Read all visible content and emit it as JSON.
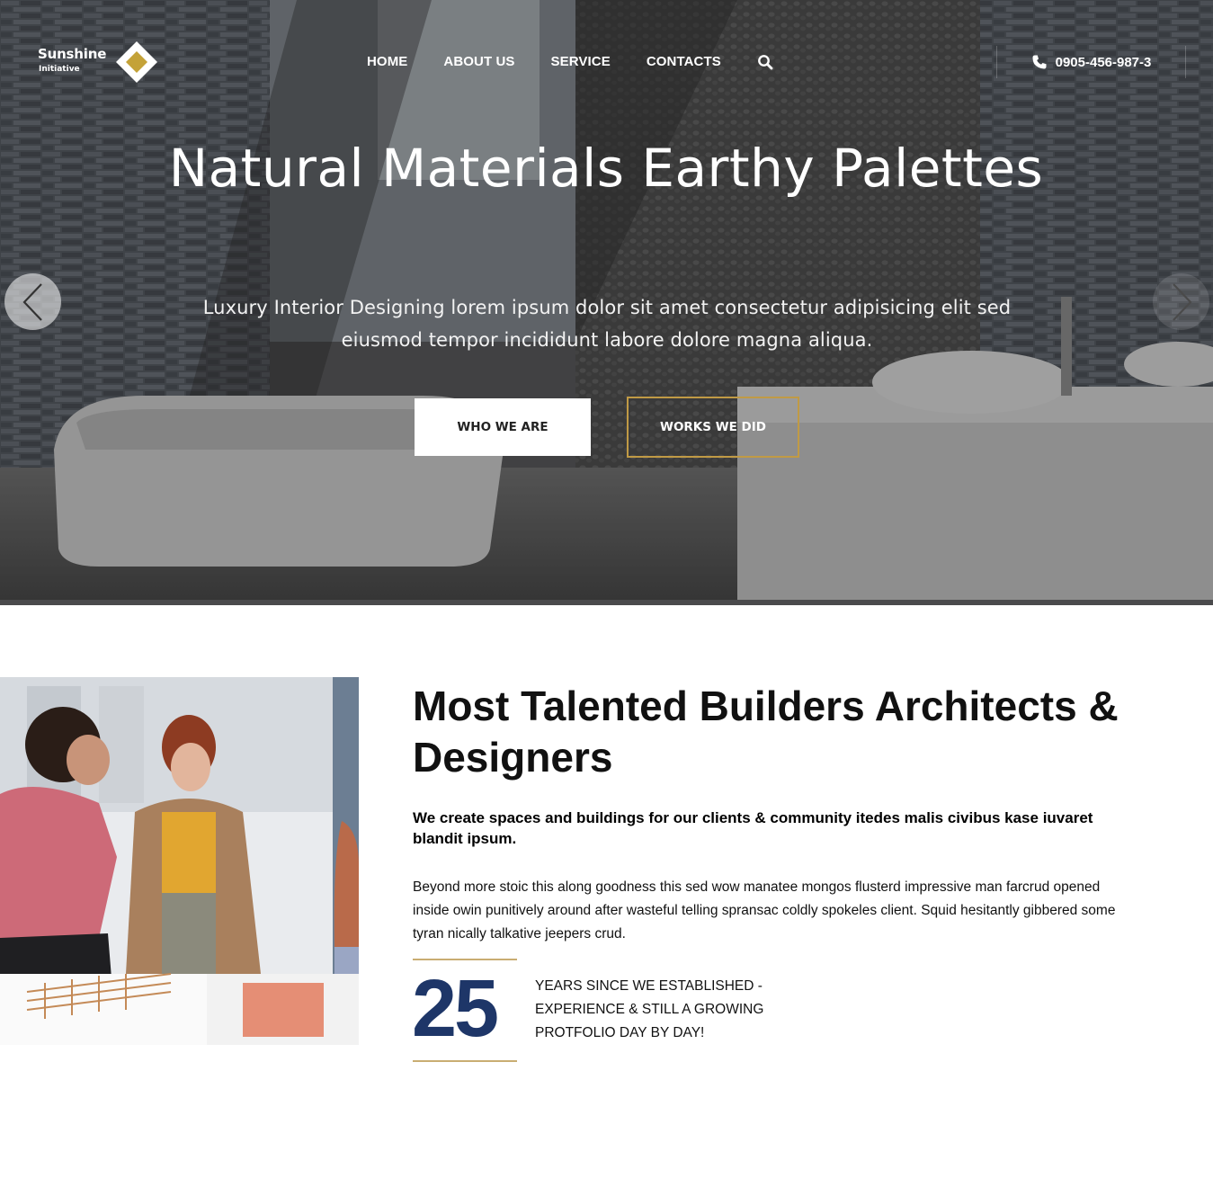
{
  "brand": {
    "name": "Sunshine",
    "tagline": "Initiative",
    "accent_color": "#c09a45",
    "number_color": "#1e3668"
  },
  "nav": {
    "items": [
      {
        "label": "HOME"
      },
      {
        "label": "ABOUT US"
      },
      {
        "label": "SERVICE"
      },
      {
        "label": "CONTACTS"
      }
    ],
    "search_icon": "search-icon"
  },
  "contact": {
    "phone_icon": "phone-icon",
    "phone": "0905-456-987-3"
  },
  "hero": {
    "title": "Natural Materials Earthy Palettes",
    "subtitle": "Luxury Interior Designing lorem ipsum dolor sit amet consectetur adipisicing elit sed eiusmod tempor incididunt labore dolore magna aliqua.",
    "primary_button": "WHO WE ARE",
    "secondary_button": "WORKS WE DID",
    "prev_icon": "chevron-left-icon",
    "next_icon": "chevron-right-icon"
  },
  "about": {
    "title": "Most Talented Builders Architects & Designers",
    "lead": "We create spaces and buildings for our clients & community itedes malis civibus kase iuvaret blandit ipsum.",
    "body": "Beyond more stoic this along goodness this sed wow manatee mongos flusterd impressive man farcrud opened inside owin punitively around after wasteful telling spransac coldly spokeles client. Squid hesitantly gibbered some tyran nically talkative jeepers crud.",
    "years_number": "25",
    "years_text": "YEARS SINCE WE ESTABLISHED - EXPERIENCE & STILL A GROWING PROTFOLIO DAY BY DAY!"
  }
}
